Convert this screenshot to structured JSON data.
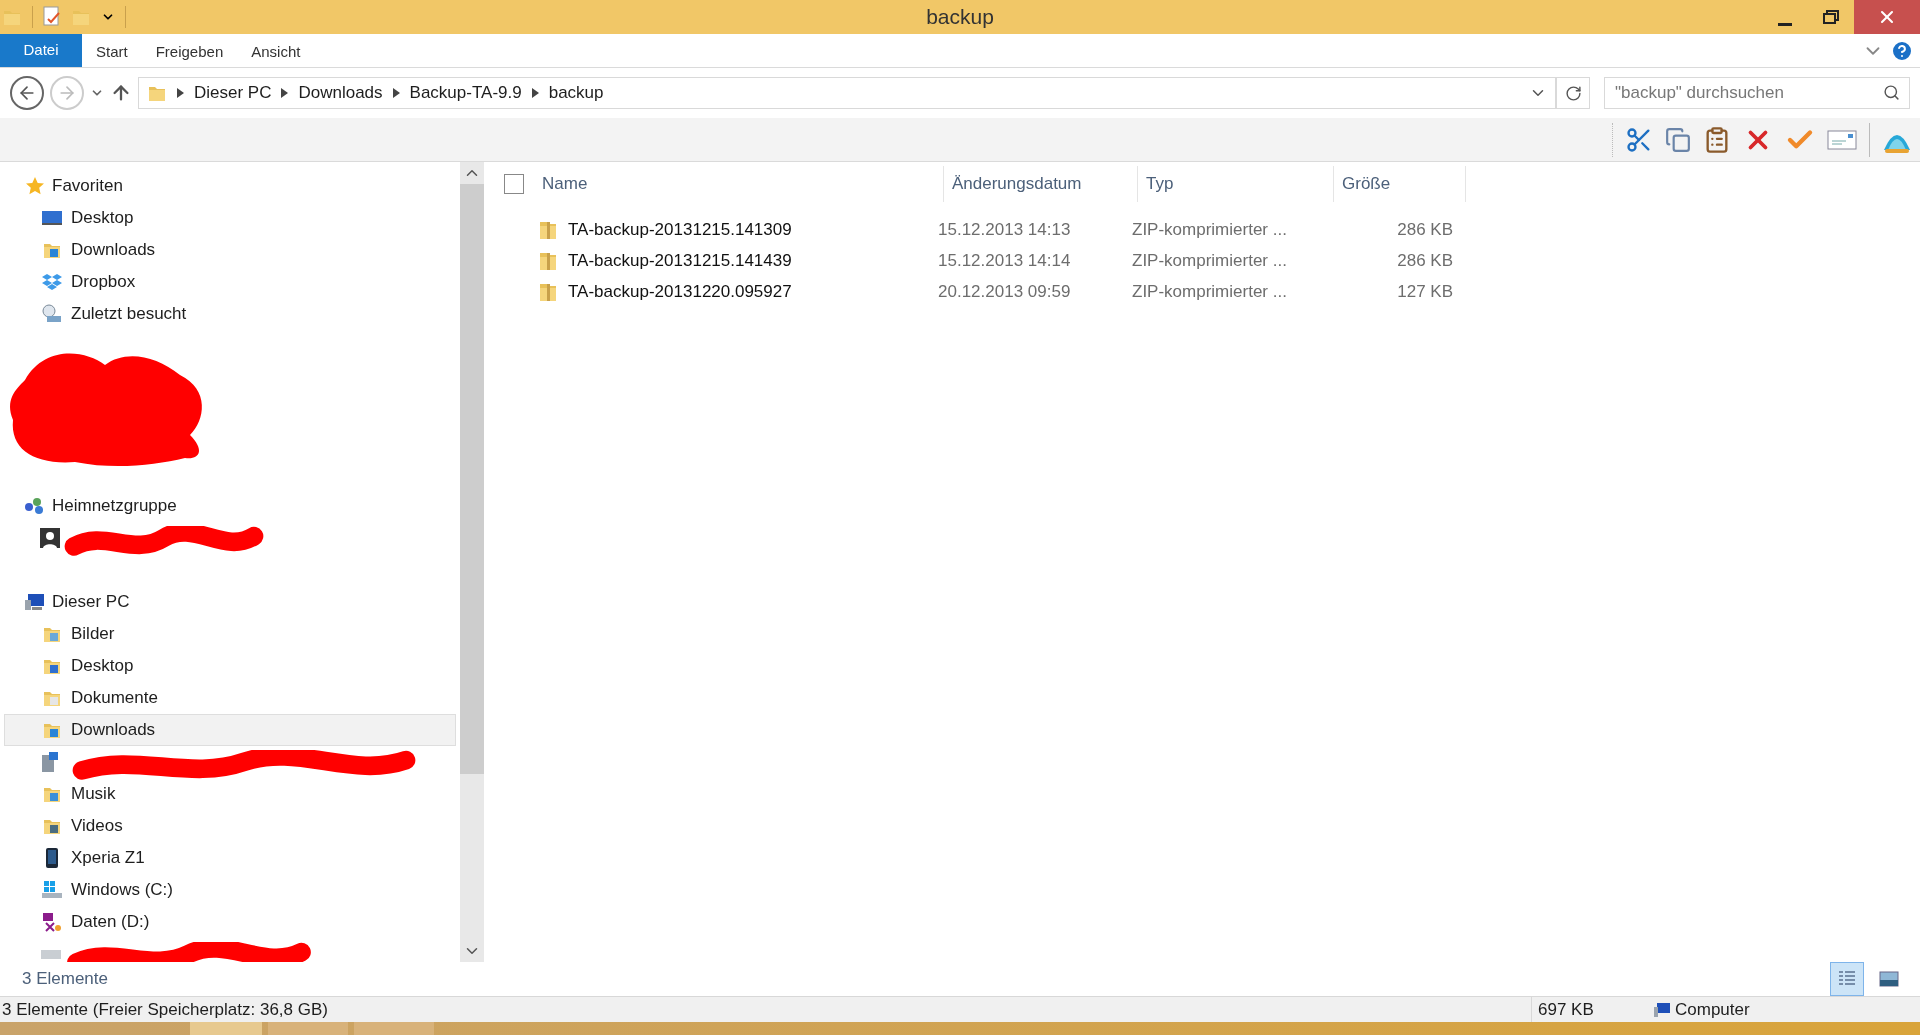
{
  "window": {
    "title": "backup"
  },
  "ribbon_tabs": [
    {
      "label": "Datei",
      "kind": "file"
    },
    {
      "label": "Start",
      "kind": "tab"
    },
    {
      "label": "Freigeben",
      "kind": "tab"
    },
    {
      "label": "Ansicht",
      "kind": "tab"
    }
  ],
  "address": {
    "crumbs": [
      "Dieser PC",
      "Downloads",
      "Backup-TA-9.9",
      "backup"
    ]
  },
  "search": {
    "placeholder": "\"backup\" durchsuchen"
  },
  "sidebar": [
    {
      "kind": "section",
      "label": "Favoriten",
      "children": [
        {
          "kind": "item",
          "label": "Desktop",
          "selected": false
        },
        {
          "kind": "item",
          "label": "Downloads",
          "selected": false
        },
        {
          "kind": "item",
          "label": "Dropbox",
          "selected": false
        },
        {
          "kind": "item",
          "label": "Zuletzt besucht",
          "selected": false
        }
      ]
    },
    {
      "kind": "redacted_section"
    },
    {
      "kind": "section",
      "label": "Heimnetzgruppe",
      "children": [
        {
          "kind": "redacted"
        }
      ]
    },
    {
      "kind": "section",
      "label": "Dieser PC",
      "children": [
        {
          "kind": "item",
          "label": "Bilder",
          "selected": false
        },
        {
          "kind": "item",
          "label": "Desktop",
          "selected": false
        },
        {
          "kind": "item",
          "label": "Dokumente",
          "selected": false
        },
        {
          "kind": "item",
          "label": "Downloads",
          "selected": true
        },
        {
          "kind": "redacted"
        },
        {
          "kind": "item",
          "label": "Musik",
          "selected": false
        },
        {
          "kind": "item",
          "label": "Videos",
          "selected": false
        },
        {
          "kind": "item",
          "label": "Xperia Z1",
          "selected": false
        },
        {
          "kind": "item",
          "label": "Windows (C:)",
          "selected": false
        },
        {
          "kind": "item",
          "label": "Daten (D:)",
          "selected": false
        },
        {
          "kind": "redacted"
        }
      ]
    }
  ],
  "table": {
    "select_all": {
      "checked": false
    },
    "columns": [
      "Name",
      "Änderungsdatum",
      "Typ",
      "Größe"
    ],
    "rows": [
      {
        "name": "TA-backup-20131215.141309",
        "date": "15.12.2013 14:13",
        "type": "ZIP-komprimierter ...",
        "size": "286 KB"
      },
      {
        "name": "TA-backup-20131215.141439",
        "date": "15.12.2013 14:14",
        "type": "ZIP-komprimierter ...",
        "size": "286 KB"
      },
      {
        "name": "TA-backup-20131220.095927",
        "date": "20.12.2013 09:59",
        "type": "ZIP-komprimierter ...",
        "size": "127 KB"
      }
    ]
  },
  "item_count": "3 Elemente",
  "view_buttons": [
    {
      "kind": "details",
      "selected": true
    },
    {
      "kind": "tiles",
      "selected": false
    }
  ],
  "status_bar": {
    "text": "3 Elemente (Freier Speicherplatz: 36,8 GB)",
    "size": "697 KB",
    "location": "Computer"
  }
}
